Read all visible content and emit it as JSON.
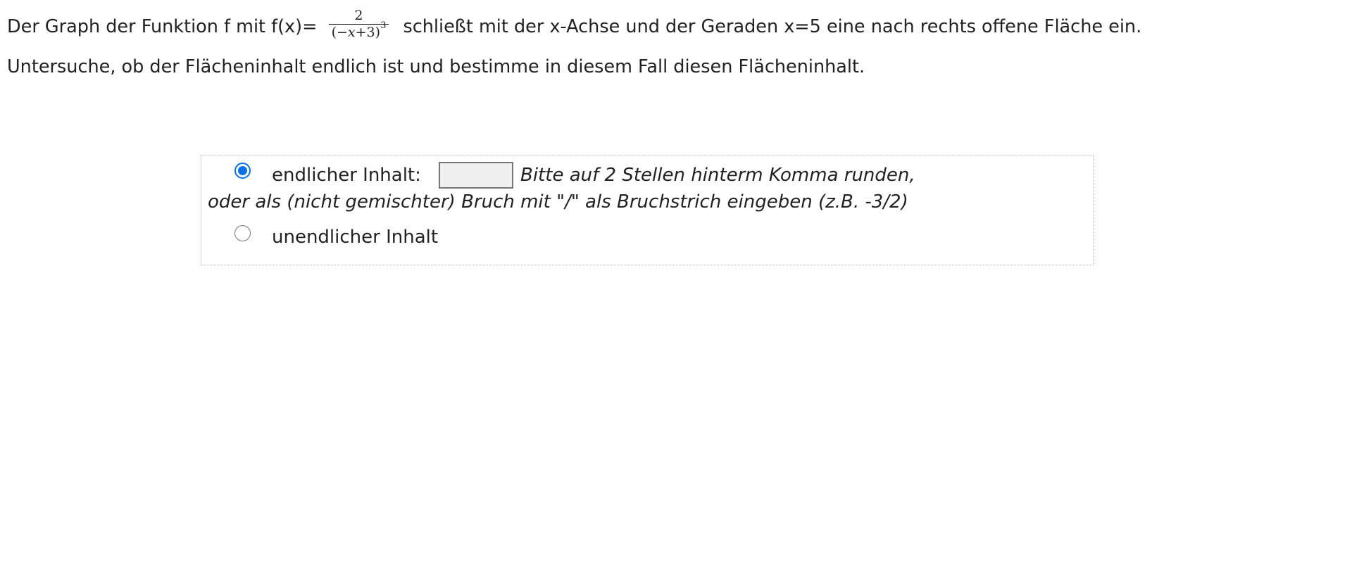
{
  "question": {
    "line1_before": "Der Graph der Funktion f mit f(x)=",
    "formula": {
      "numerator": "2",
      "denominator_open": "(",
      "denominator_minus": "−",
      "denominator_var": "x",
      "denominator_rest": "+3)",
      "exponent": "3"
    },
    "line1_after": "schließt mit der x-Achse und der Geraden x=5 eine nach rechts offene Fläche ein.",
    "line2": "Untersuche, ob der Flächeninhalt endlich ist und bestimme in diesem Fall diesen Flächeninhalt."
  },
  "answer": {
    "finite_option_label": "endlicher Inhalt:",
    "finite_option_selected": true,
    "input_value": "",
    "hint_line1": "Bitte auf 2 Stellen hinterm Komma runden,",
    "hint_line2": "oder als (nicht gemischter) Bruch mit \"/\" als Bruchstrich eingeben (z.B. -3/2)",
    "infinite_option_label": "unendlicher Inhalt",
    "infinite_option_selected": false
  },
  "colors": {
    "text": "#222222",
    "radio_accent": "#0a72e6",
    "input_background": "#efefef",
    "box_border": "#bbbbbb"
  }
}
